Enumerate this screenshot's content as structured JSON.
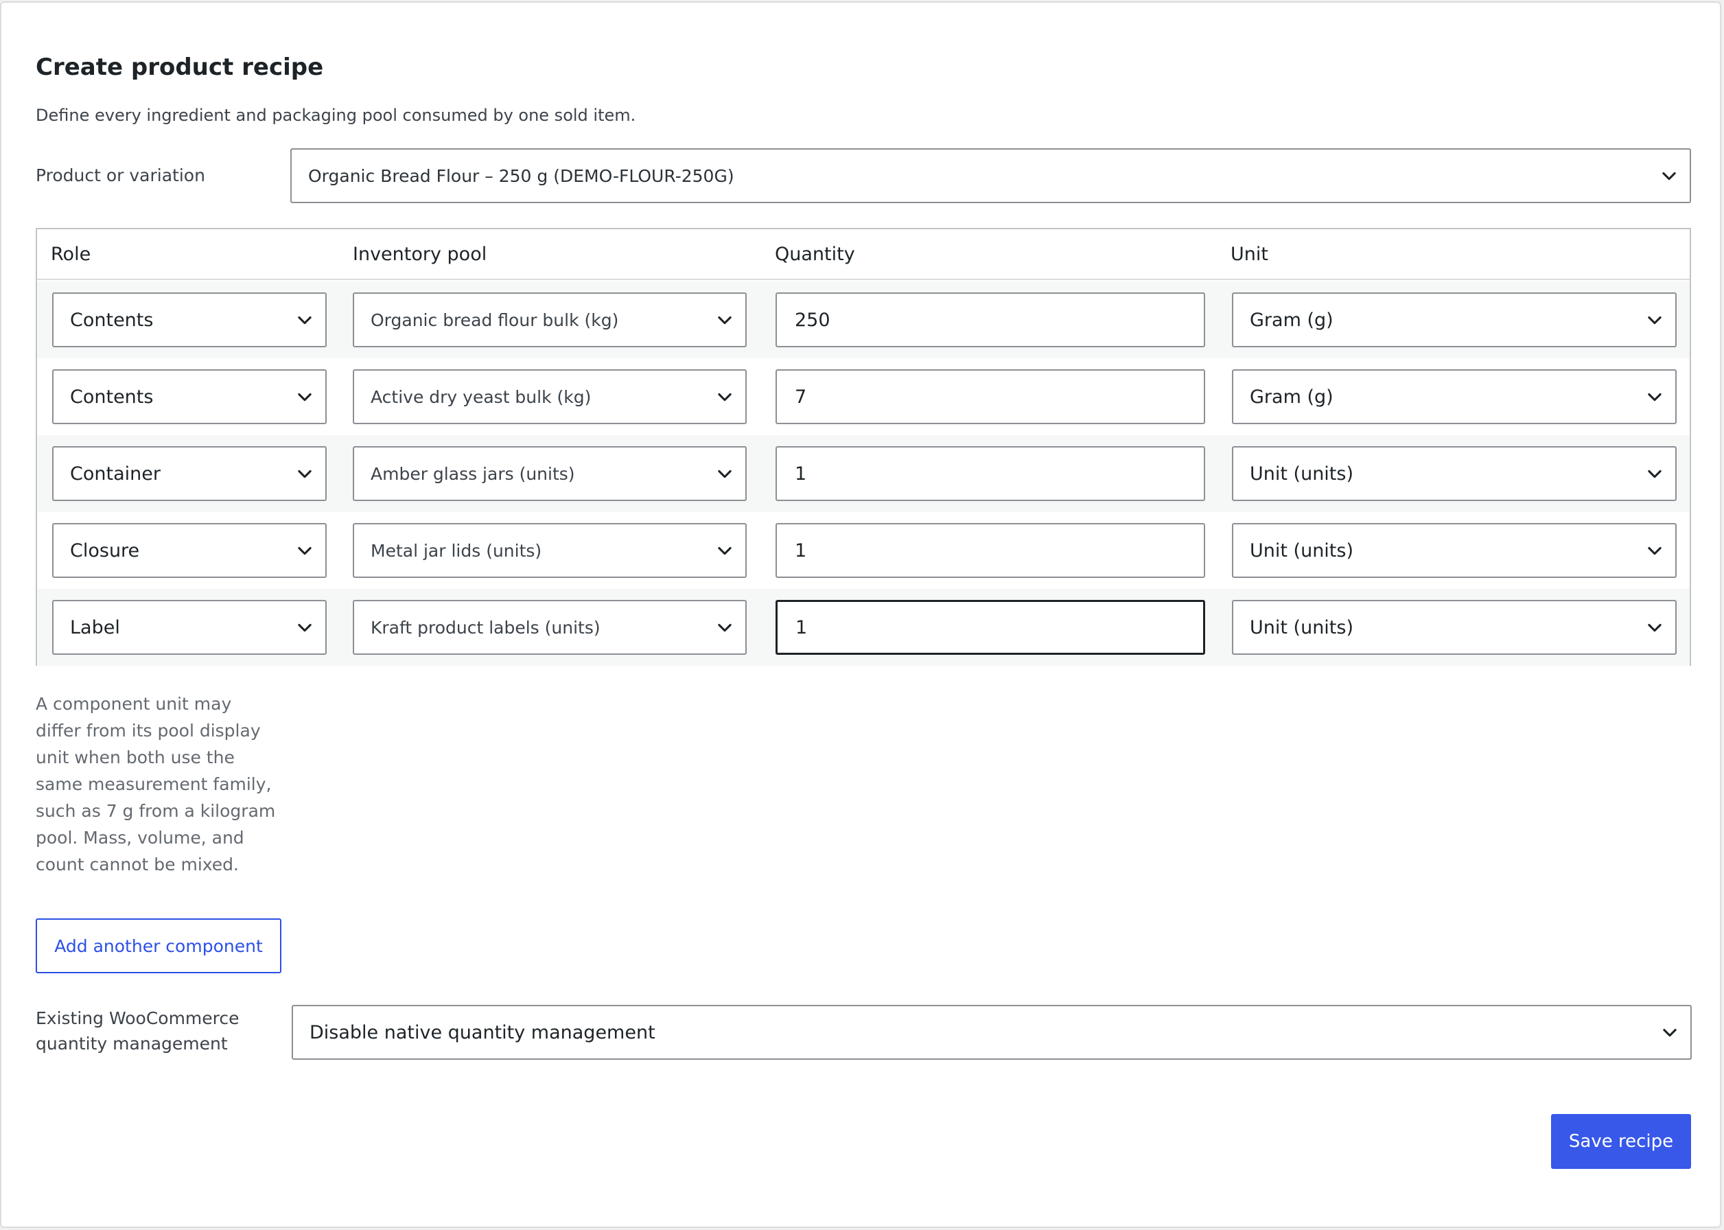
{
  "page": {
    "title": "Create product recipe",
    "description": "Define every ingredient and packaging pool consumed by one sold item."
  },
  "product": {
    "label": "Product or variation",
    "selected": "Organic Bread Flour – 250 g (DEMO-FLOUR-250G)"
  },
  "table": {
    "headers": {
      "role": "Role",
      "pool": "Inventory pool",
      "quantity": "Quantity",
      "unit": "Unit"
    },
    "rows": [
      {
        "role": "Contents",
        "pool": "Organic bread flour bulk (kg)",
        "quantity": "250",
        "unit": "Gram (g)"
      },
      {
        "role": "Contents",
        "pool": "Active dry yeast bulk (kg)",
        "quantity": "7",
        "unit": "Gram (g)"
      },
      {
        "role": "Container",
        "pool": "Amber glass jars (units)",
        "quantity": "1",
        "unit": "Unit (units)"
      },
      {
        "role": "Closure",
        "pool": "Metal jar lids (units)",
        "quantity": "1",
        "unit": "Unit (units)"
      },
      {
        "role": "Label",
        "pool": "Kraft product labels (units)",
        "quantity": "1",
        "unit": "Unit (units)"
      }
    ]
  },
  "help_text": "A component unit may differ from its pool display unit when both use the same measurement family, such as 7 g from a kilogram pool. Mass, volume, and count cannot be mixed.",
  "add_button": "Add another component",
  "existing": {
    "label": "Existing WooCommerce quantity management",
    "selected": "Disable native quantity management"
  },
  "save_button": "Save recipe",
  "icons": {
    "select_arrow": "chevron-down-icon"
  },
  "colors": {
    "accent": "#3858e9",
    "border": "#8c8f94",
    "text": "#1d2327",
    "muted": "#646970"
  }
}
